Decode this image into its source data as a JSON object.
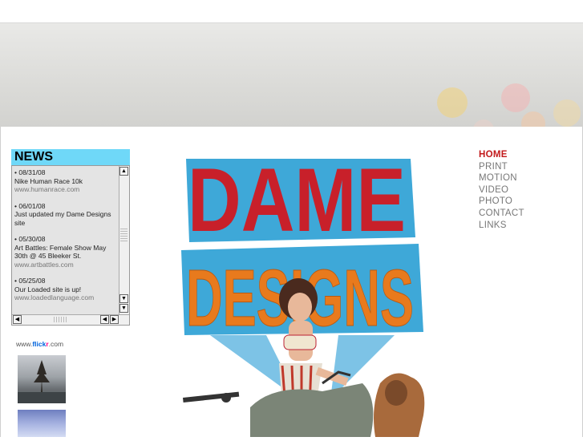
{
  "news": {
    "title": "NEWS",
    "items": [
      {
        "date": "• 08/31/08",
        "text": "Nike Human Race 10k",
        "url": "www.humanrace.com"
      },
      {
        "date": "• 06/01/08",
        "text": "Just updated my Dame Designs site",
        "url": ""
      },
      {
        "date": "• 05/30/08",
        "text": "Art Battles: Female Show May 30th @ 45 Bleeker St.",
        "url": "www.artbattles.com"
      },
      {
        "date": "• 05/25/08",
        "text": "Our Loaded site is up!",
        "url": "www.loadedlanguage.com"
      }
    ]
  },
  "flickr": {
    "prefix": "www.",
    "fl": "flick",
    "r": "r",
    "suffix": ".com"
  },
  "logo": {
    "line1": "DAME",
    "line2": "DESIGNS"
  },
  "nav": {
    "items": [
      {
        "label": "HOME",
        "active": true
      },
      {
        "label": "PRINT"
      },
      {
        "label": "MOTION"
      },
      {
        "label": "VIDEO"
      },
      {
        "label": "PHOTO"
      },
      {
        "label": "CONTACT"
      },
      {
        "label": "LINKS"
      }
    ]
  },
  "colors": {
    "accent_nav": "#c2191b",
    "news_header": "#6fd8f8",
    "logo_red": "#c8202a",
    "logo_orange": "#e87a1d",
    "logo_blue": "#3ea8d8"
  }
}
